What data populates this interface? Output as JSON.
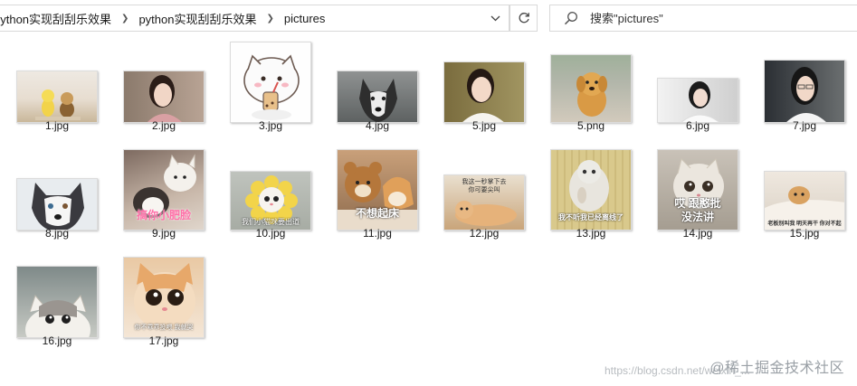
{
  "breadcrumb": {
    "items": [
      "python实现刮刮乐效果",
      "python实现刮刮乐效果",
      "pictures"
    ]
  },
  "search": {
    "placeholder": "搜索\"pictures\""
  },
  "files": [
    {
      "name": "1.jpg",
      "thumb": "figurines"
    },
    {
      "name": "2.jpg",
      "thumb": "portrait-woman"
    },
    {
      "name": "3.jpg",
      "thumb": "cartoon-cat-bubble-tea"
    },
    {
      "name": "4.jpg",
      "thumb": "husky"
    },
    {
      "name": "5.jpg",
      "thumb": "portrait-woman"
    },
    {
      "name": "5.png",
      "thumb": "golden-puppy"
    },
    {
      "name": "6.jpg",
      "thumb": "portrait-woman"
    },
    {
      "name": "7.jpg",
      "thumb": "portrait-woman"
    },
    {
      "name": "8.jpg",
      "thumb": "husky-face"
    },
    {
      "name": "9.jpg",
      "thumb": "cats-meme",
      "caption": "搞你小肥脸"
    },
    {
      "name": "10.jpg",
      "thumb": "cat-flower-meme",
      "caption": "我们小猫咪要出道"
    },
    {
      "name": "11.jpg",
      "thumb": "bear-dog-meme",
      "caption": "不想起床"
    },
    {
      "name": "12.jpg",
      "thumb": "cat-lying-meme",
      "caption_top": "我这一秒掌下去 你可要尖叫"
    },
    {
      "name": "13.jpg",
      "thumb": "cat-floor-meme",
      "caption": "我不听我已经离线了"
    },
    {
      "name": "14.jpg",
      "thumb": "fluffy-cat-meme",
      "caption": "哎 跟憨批没法讲"
    },
    {
      "name": "15.jpg",
      "thumb": "dog-bed-meme",
      "caption": "老板别叫我 明天再干 你对不起"
    },
    {
      "name": "16.jpg",
      "thumb": "kitten-peek"
    },
    {
      "name": "17.jpg",
      "thumb": "orange-kitten-meme",
      "caption": "你不乖乖投喂 我就哭"
    }
  ],
  "watermark": {
    "text": "@稀土掘金技术社区",
    "url": "https://blog.csdn.net/weixin_..."
  },
  "colors": {
    "border": "#d9d9d9",
    "background": "#ffffff",
    "text": "#1a1a1a"
  }
}
